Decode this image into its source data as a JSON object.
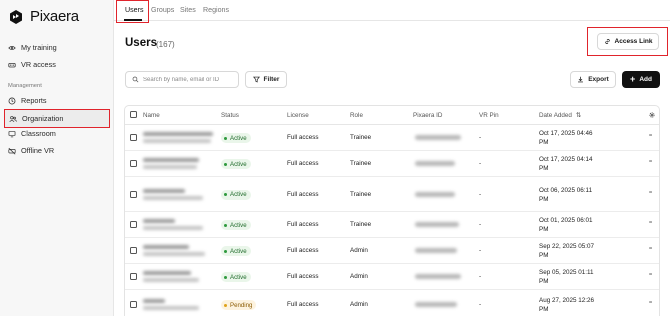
{
  "brand": {
    "name": "Pixaera"
  },
  "sidebar": {
    "items": [
      {
        "label": "My training",
        "icon": "eye-icon"
      },
      {
        "label": "VR access",
        "icon": "vr-headset-icon"
      }
    ],
    "section_label": "Management",
    "management_items": [
      {
        "label": "Reports",
        "icon": "clock-icon"
      },
      {
        "label": "Organization",
        "icon": "users-icon",
        "active": true
      },
      {
        "label": "Classroom",
        "icon": "monitor-icon"
      },
      {
        "label": "Offline VR",
        "icon": "vr-offline-icon"
      }
    ]
  },
  "tabs": [
    {
      "label": "Users",
      "active": true
    },
    {
      "label": "Groups"
    },
    {
      "label": "Sites"
    },
    {
      "label": "Regions"
    }
  ],
  "header": {
    "title": "Users",
    "count": "(167)",
    "access_link_label": "Access Link"
  },
  "toolbar": {
    "search_placeholder": "Search by name, email or ID",
    "filter_label": "Filter",
    "export_label": "Export",
    "add_label": "Add"
  },
  "table": {
    "columns": [
      "Name",
      "Status",
      "License",
      "Role",
      "Pixaera ID",
      "VR Pin",
      "Date Added"
    ],
    "sort_icon": "sort-arrows-icon",
    "rows": [
      {
        "status": "Active",
        "license": "Full access",
        "role": "Trainee",
        "vr_pin": "-",
        "date": "Oct 17, 2025 04:46",
        "time_suffix": "PM"
      },
      {
        "status": "Active",
        "license": "Full access",
        "role": "Trainee",
        "vr_pin": "-",
        "date": "Oct 17, 2025 04:14",
        "time_suffix": "PM"
      },
      {
        "status": "Active",
        "license": "Full access",
        "role": "Trainee",
        "vr_pin": "-",
        "date": "Oct 06, 2025 06:11",
        "time_suffix": "PM"
      },
      {
        "status": "Active",
        "license": "Full access",
        "role": "Trainee",
        "vr_pin": "-",
        "date": "Oct 01, 2025 06:01",
        "time_suffix": "PM"
      },
      {
        "status": "Active",
        "license": "Full access",
        "role": "Admin",
        "vr_pin": "-",
        "date": "Sep 22, 2025 05:07",
        "time_suffix": "PM"
      },
      {
        "status": "Active",
        "license": "Full access",
        "role": "Admin",
        "vr_pin": "-",
        "date": "Sep 05, 2025 01:11",
        "time_suffix": "PM"
      },
      {
        "status": "Pending",
        "license": "Full access",
        "role": "Admin",
        "vr_pin": "-",
        "date": "Aug 27, 2025 12:26",
        "time_suffix": "PM"
      }
    ]
  },
  "colors": {
    "highlight": "#e0242c",
    "active_status": "#2f9a3e",
    "pending_status": "#e0a21a",
    "primary_button": "#111111"
  }
}
